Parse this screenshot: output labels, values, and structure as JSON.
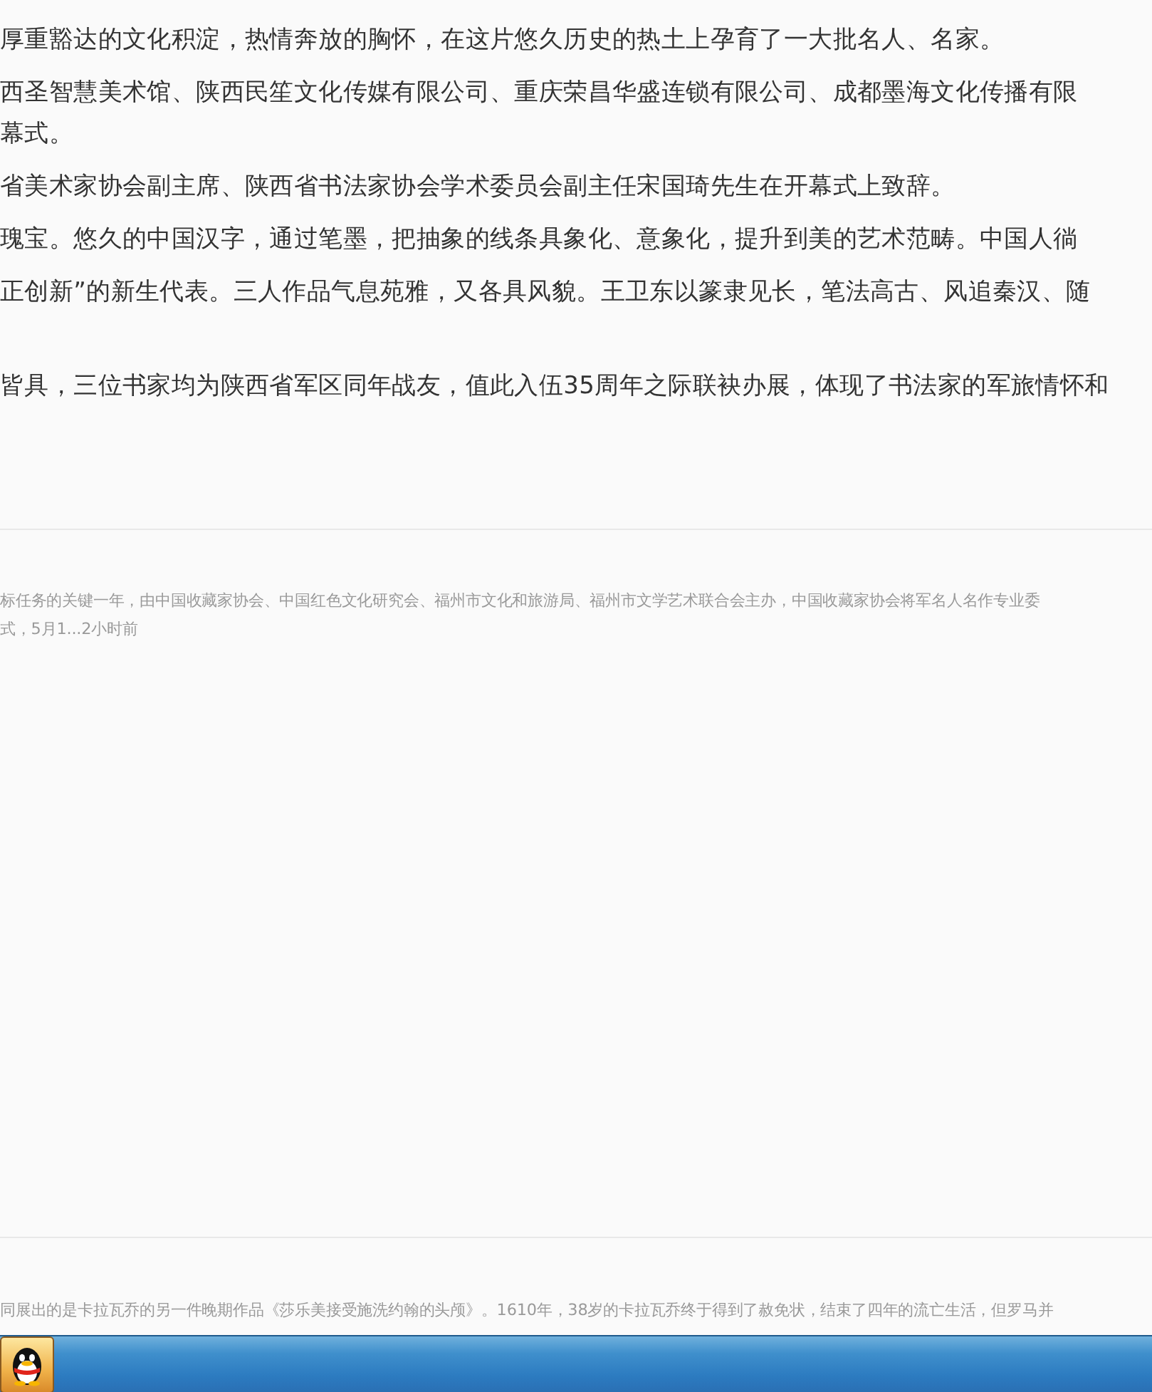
{
  "article": {
    "paragraphs": [
      {
        "lines": [
          "厚重豁达的文化积淀，热情奔放的胸怀，在这片悠久历史的热土上孕育了一大批名人、名家。"
        ]
      },
      {
        "lines": [
          "西圣智慧美术馆、陕西民笙文化传媒有限公司、重庆荣昌华盛连锁有限公司、成都墨海文化传播有限",
          "幕式。"
        ]
      },
      {
        "lines": [
          "省美术家协会副主席、陕西省书法家协会学术委员会副主任宋国琦先生在开幕式上致辞。"
        ]
      },
      {
        "lines": [
          "瑰宝。悠久的中国汉字，通过笔墨，把抽象的线条具象化、意象化，提升到美的艺术范畴。中国人徜"
        ]
      },
      {
        "lines": [
          "正创新”的新生代表。三人作品气息苑雅，又各具风貌。王卫东以篆隶见长，笔法高古、风追秦汉、随"
        ]
      },
      {
        "lines": [
          "皆具，三位书家均为陕西省军区同年战友，值此入伍35周年之际联袂办展，体现了书法家的军旅情怀和"
        ]
      }
    ]
  },
  "feed_items": [
    {
      "summary_lines": [
        "标任务的关键一年，由中国收藏家协会、中国红色文化研究会、福州市文化和旅游局、福州市文学艺术联合会主办，中国收藏家协会将军名人名作专业委",
        "式，5月1...2小时前"
      ]
    },
    {
      "summary_lines": [
        "同展出的是卡拉瓦乔的另一件晚期作品《莎乐美接受施洗约翰的头颅》。1610年，38岁的卡拉瓦乔终于得到了赦免状，结束了四年的流亡生活，但罗马并"
      ]
    }
  ],
  "taskbar": {
    "buttons": [
      {
        "kind": "qq"
      }
    ]
  }
}
